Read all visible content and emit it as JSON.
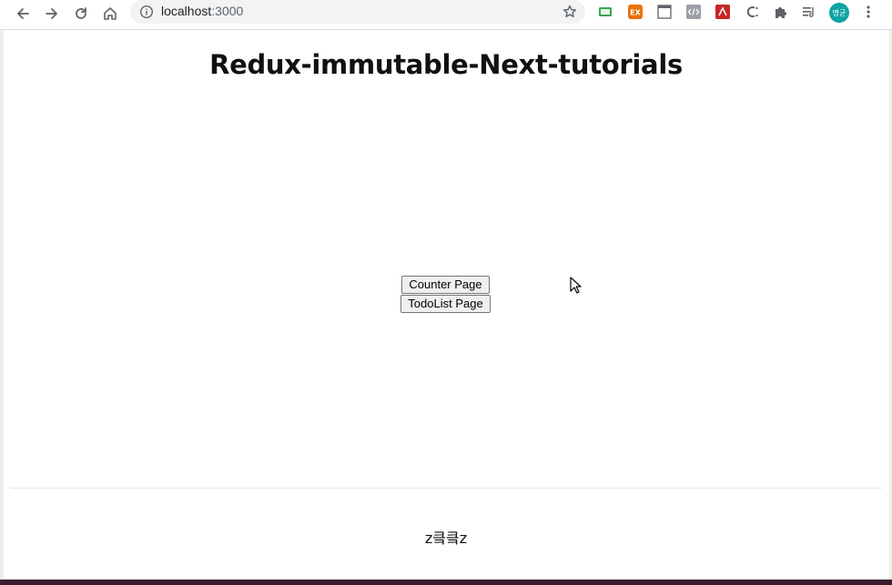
{
  "browser": {
    "url_host": "localhost",
    "url_port": ":3000",
    "profile_initial": "명균"
  },
  "page": {
    "title": "Redux-immutable-Next-tutorials",
    "buttons": [
      {
        "label": "Counter Page"
      },
      {
        "label": "TodoList Page"
      }
    ],
    "footer_text": "z킄킄z"
  },
  "colors": {
    "profile_avatar": "#0fa3a3",
    "ext_ex": "#e8710a",
    "ext_red": "#c62828"
  }
}
